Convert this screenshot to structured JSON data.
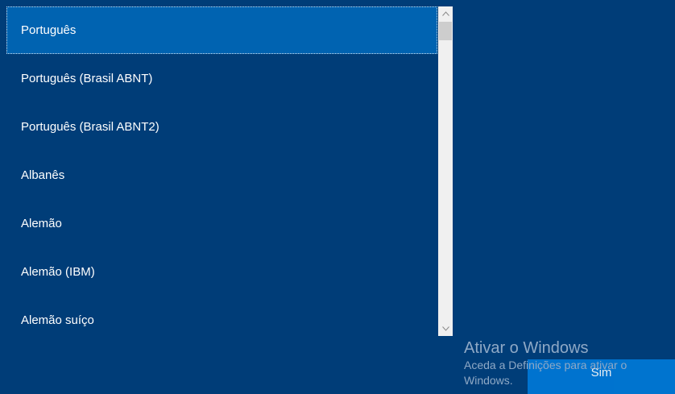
{
  "layout_list": {
    "items": [
      {
        "label": "Português",
        "selected": true
      },
      {
        "label": "Português (Brasil ABNT)",
        "selected": false
      },
      {
        "label": "Português (Brasil ABNT2)",
        "selected": false
      },
      {
        "label": "Albanês",
        "selected": false
      },
      {
        "label": "Alemão",
        "selected": false
      },
      {
        "label": "Alemão (IBM)",
        "selected": false
      },
      {
        "label": "Alemão suíço",
        "selected": false
      }
    ]
  },
  "scrollbar": {
    "up_icon": "chevron-up-icon",
    "down_icon": "chevron-down-icon"
  },
  "activation_watermark": {
    "title": "Ativar o Windows",
    "text": "Aceda a Definições para ativar o Windows."
  },
  "actions": {
    "yes_label": "Sim"
  },
  "colors": {
    "background": "#003d78",
    "selected_item": "#0063b1",
    "button": "#0078d7"
  }
}
